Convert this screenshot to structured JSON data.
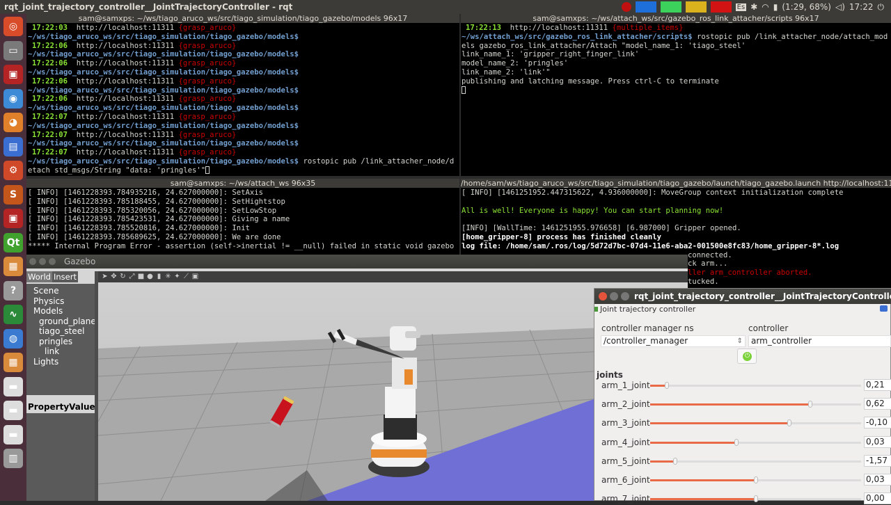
{
  "topbar": {
    "title": "rqt_joint_trajectory_controller__JointTrajectoryController - rqt",
    "keyboard": "Es",
    "battery": "(1:29, 68%)",
    "clock": "17:22",
    "colors": {
      "panel": "#3c3b37",
      "launcher": "#4a2e3a"
    }
  },
  "launcher": {
    "icons": [
      "ubuntu-icon",
      "files-icon",
      "terminal-icon",
      "chrome-icon",
      "firefox-icon",
      "writer-icon",
      "settings-icon",
      "sublime-icon",
      "terminal2-icon",
      "qt-icon",
      "box-icon",
      "help-icon",
      "monitor-icon",
      "globe-icon",
      "box2-icon",
      "drive-icon",
      "drive2-icon",
      "drive3-icon",
      "trash-icon"
    ],
    "icon_labels": [
      "◎",
      "▭",
      "▣",
      "◉",
      "◕",
      "▤",
      "⚙",
      "S",
      "▣",
      "Qt",
      "▦",
      "?",
      "∿",
      "◍",
      "▦",
      "▬",
      "▬",
      "▬",
      "▥"
    ]
  },
  "terminal_tl": {
    "title": "sam@samxps: ~/ws/tiago_aruco_ws/src/tiago_simulation/tiago_gazebo/models 96x17",
    "lines": [
      {
        "time": "17:22:03",
        "url": "http://localhost:11311",
        "tag": "{grasp_aruco}"
      },
      {
        "time": "17:22:06",
        "url": "http://localhost:11311",
        "tag": "{grasp_aruco}"
      },
      {
        "time": "17:22:06",
        "url": "http://localhost:11311",
        "tag": "{grasp_aruco}"
      },
      {
        "time": "17:22:06",
        "url": "http://localhost:11311",
        "tag": "{grasp_aruco}"
      },
      {
        "time": "17:22:06",
        "url": "http://localhost:11311",
        "tag": "{grasp_aruco}"
      },
      {
        "time": "17:22:07",
        "url": "http://localhost:11311",
        "tag": "{grasp_aruco}"
      },
      {
        "time": "17:22:07",
        "url": "http://localhost:11311",
        "tag": "{grasp_aruco}"
      },
      {
        "time": "17:22:07",
        "url": "http://localhost:11311",
        "tag": "{grasp_aruco}"
      }
    ],
    "path": "~/ws/tiago_aruco_ws/src/tiago_simulation/tiago_gazebo/models$",
    "last_cmd": " rostopic pub /link_attacher_node/d",
    "last_cmd2": "etach std_msgs/String \"data: 'pringles'\"",
    "first_prompt": "~/ws/tiago_aruco_ws/src/tiago_simulation/tiago_gazebo/models$"
  },
  "terminal_tr": {
    "title": "sam@samxps: ~/ws/attach_ws/src/gazebo_ros_link_attacher/scripts 96x17",
    "time": "17:22:13",
    "url": "http://localhost:11311",
    "tag": "{multiple_items}",
    "path": "~/ws/attach_ws/src/gazebo_ros_link_attacher/scripts$",
    "cmd": " rostopic pub /link_attacher_node/attach_mod",
    "lines": [
      "els gazebo_ros_link_attacher/Attach \"model_name_1: 'tiago_steel'",
      "link_name_1: 'gripper_right_finger_link'",
      "model_name_2: 'pringles'",
      "link_name_2: 'link'\"",
      "publishing and latching message. Press ctrl-C to terminate"
    ]
  },
  "terminal_bl": {
    "title": "sam@samxps: ~/ws/attach_ws 96x35",
    "lines": [
      "[ INFO] [1461228393.784935216, 24.627000000]: SetAxis",
      "[ INFO] [1461228393.785188455, 24.627000000]: SetHightstop",
      "[ INFO] [1461228393.785320056, 24.627000000]: SetLowStop",
      "[ INFO] [1461228393.785423531, 24.627000000]: Giving a name",
      "[ INFO] [1461228393.785520816, 24.627000000]: Init",
      "[ INFO] [1461228393.785689625, 24.627000000]: We are done",
      "***** Internal Program Error - assertion (self->inertial != __null) failed in static void gazebo"
    ]
  },
  "terminal_br": {
    "title": "/home/sam/ws/tiago_aruco_ws/src/tiago_simulation/tiago_gazebo/launch/tiago_gazebo.launch http://localhost:11",
    "line1": "[ INFO] [1461251952.447315622, 4.936000000]: MoveGroup context initialization complete",
    "line2": "All is well! Everyone is happy! You can start planning now!",
    "line3": "[INFO] [WallTime: 1461251955.976658] [6.987000] Gripper opened.",
    "line4": "[home_gripper-8] process has finished cleanly",
    "line5": "log file: /home/sam/.ros/log/5d72d7bc-07d4-11e6-aba2-001500e8fc83/home_gripper-8*.log",
    "frag1": "connected.",
    "frag2": "ck arm...",
    "frag3": "ller arm_controller aborted.",
    "frag4": "tucked."
  },
  "gazebo": {
    "title": "Gazebo",
    "tabs": [
      "World",
      "Insert"
    ],
    "tree": {
      "scene": "Scene",
      "physics": "Physics",
      "models": "Models",
      "model_items": [
        "ground_plane",
        "tiago_steel",
        "pringles"
      ],
      "link": "link",
      "lights": "Lights"
    },
    "prop_header": [
      "Property",
      "Value"
    ],
    "tools": [
      "arrow-icon",
      "move-icon",
      "rotate-icon",
      "scale-icon",
      "box-icon",
      "sphere-icon",
      "cylinder-icon",
      "sun-icon",
      "spot-icon",
      "dir-light-icon",
      "screenshot-icon"
    ],
    "tool_glyphs": [
      "➤",
      "✥",
      "↻",
      "⤢",
      "■",
      "●",
      "▮",
      "✳",
      "✦",
      "⟋",
      "▣"
    ]
  },
  "rqt": {
    "title": "rqt_joint_trajectory_controller__JointTrajectoryController - rqt",
    "dock_title": "Joint trajectory controller",
    "cm_label": "controller manager ns",
    "ctrl_label": "controller",
    "cm_value": "/controller_manager",
    "ctrl_value": "arm_controller",
    "joints_label": "joints",
    "joints": [
      {
        "name": "arm_1_joint",
        "value": "0,21",
        "fraction": 0.08
      },
      {
        "name": "arm_2_joint",
        "value": "0,62",
        "fraction": 0.76
      },
      {
        "name": "arm_3_joint",
        "value": "-0,10",
        "fraction": 0.66
      },
      {
        "name": "arm_4_joint",
        "value": "0,03",
        "fraction": 0.41
      },
      {
        "name": "arm_5_joint",
        "value": "-1,57",
        "fraction": 0.12
      },
      {
        "name": "arm_6_joint",
        "value": "0,03",
        "fraction": 0.5
      },
      {
        "name": "arm_7_joint",
        "value": "0,00",
        "fraction": 0.5
      }
    ],
    "accent": "#e96a46",
    "enable_color": "#7bd13a"
  }
}
